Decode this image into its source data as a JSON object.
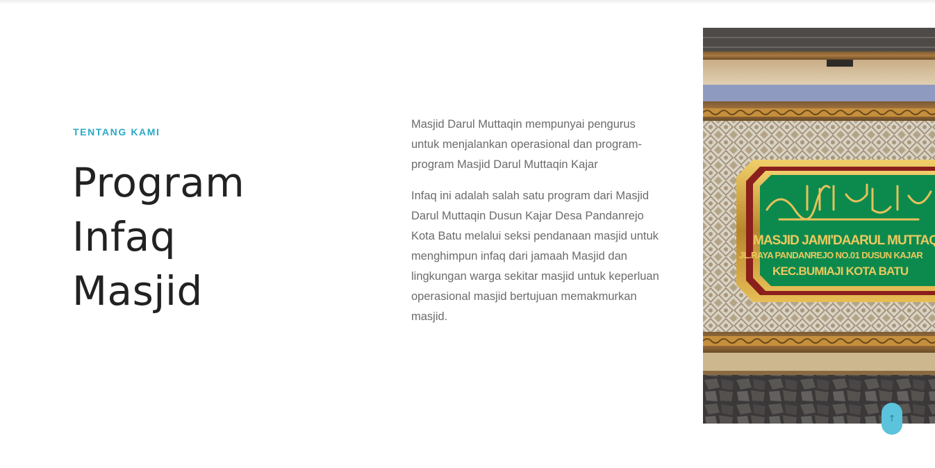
{
  "about": {
    "eyebrow": "TENTANG KAMI",
    "title_lines": [
      "Program",
      "Infaq",
      "Masjid"
    ],
    "paragraphs": [
      "Masjid Darul Muttaqin mempunyai pengurus untuk menjalankan operasional dan program-program Masjid Darul Muttaqin Kajar",
      "Infaq ini adalah salah satu program dari Masjid Darul Muttaqin Dusun Kajar Desa Pandanrejo Kota Batu melalui seksi pendanaan masjid untuk menghimpun infaq dari jamaah Masjid dan lingkungan warga sekitar masjid untuk keperluan operasional masjid bertujuan memakmurkan masjid."
    ]
  },
  "photo_sign": {
    "line1": "MASJID JAMI'DAARUL MUTTAQIN",
    "line2": "JL.RAYA PANDANREJO NO.01 DUSUN KAJAR",
    "line3": "KEC.BUMIAJI KOTA BATU"
  },
  "scroll_top": {
    "icon": "arrow-up-icon",
    "glyph": "↑"
  },
  "colors": {
    "accent": "#2aa9c7",
    "heading": "#222222",
    "body_text": "#6b6b6b",
    "sign_green": "#0c8a4e",
    "sign_gold": "#d4a537",
    "scroll_button": "#5bc3dc"
  }
}
